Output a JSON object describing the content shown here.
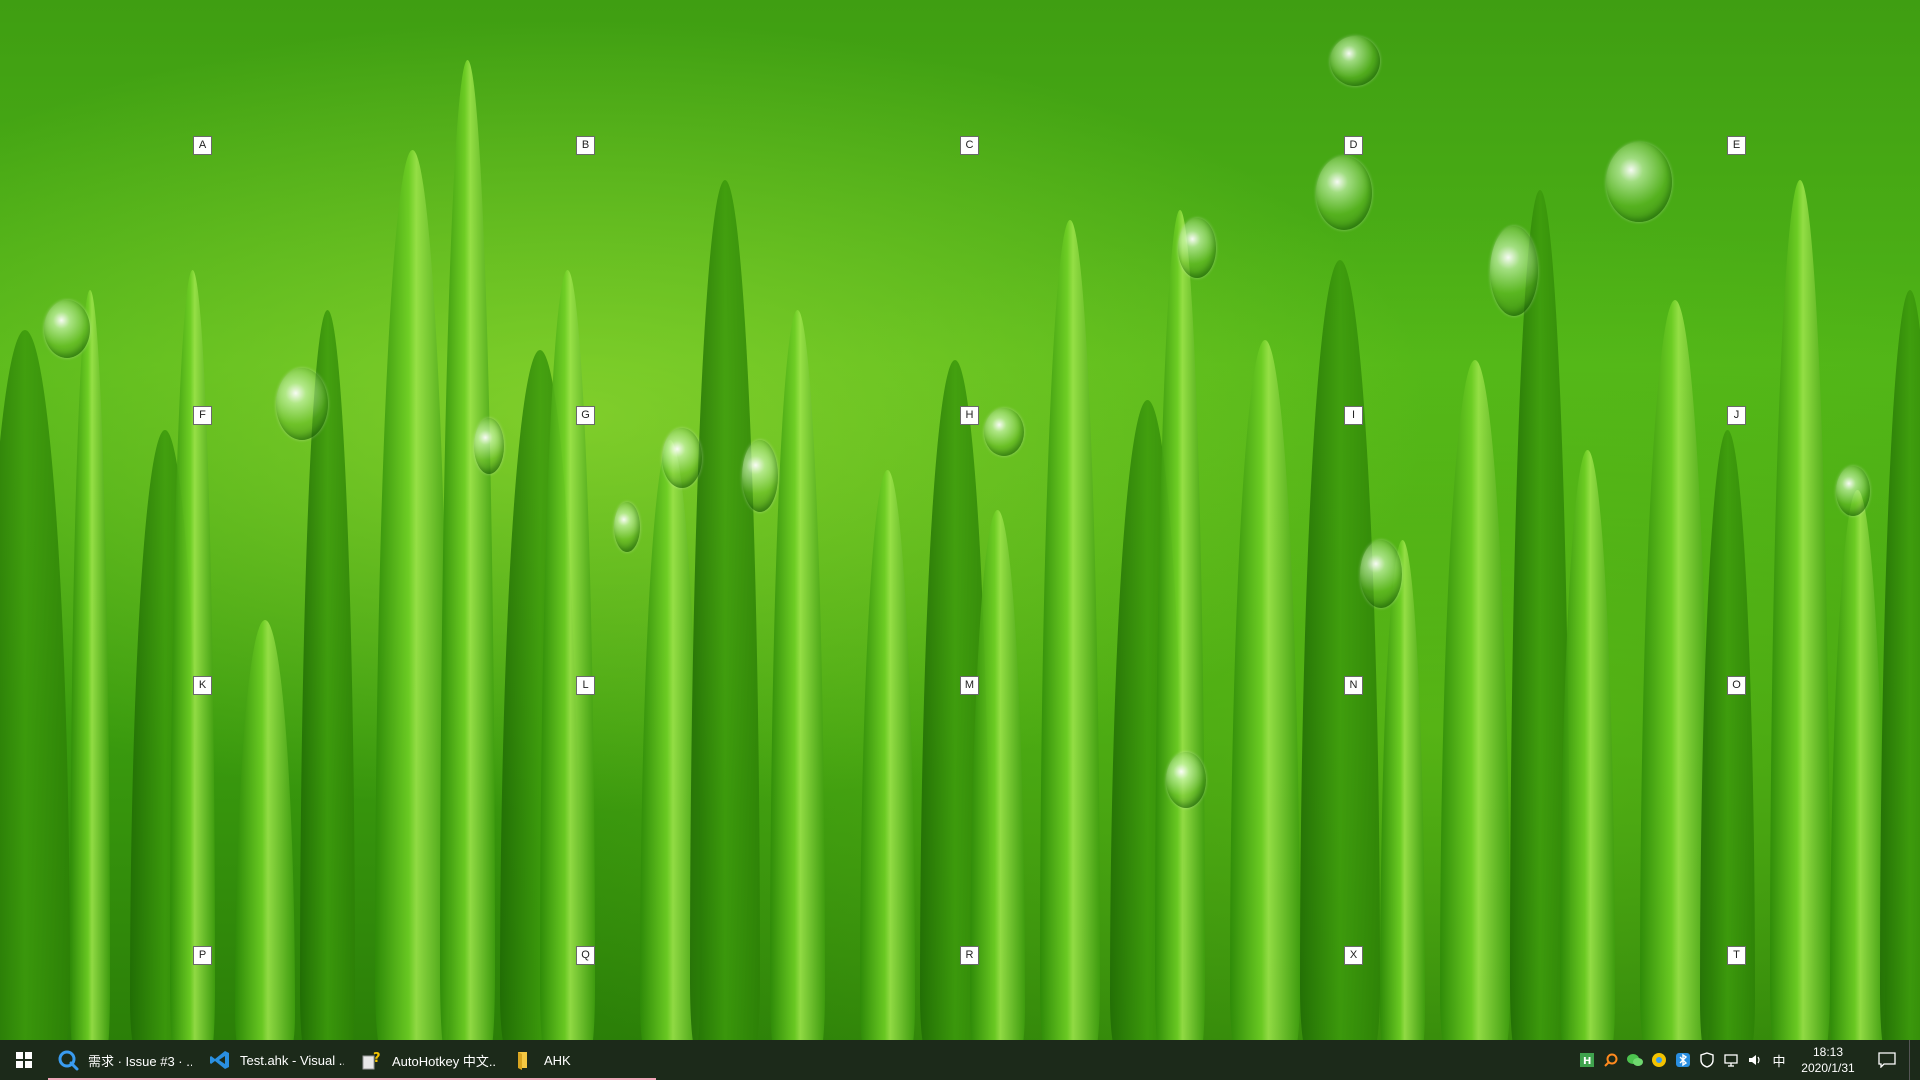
{
  "hints": [
    "A",
    "B",
    "C",
    "D",
    "E",
    "F",
    "G",
    "H",
    "I",
    "J",
    "K",
    "L",
    "M",
    "N",
    "O",
    "P",
    "Q",
    "R",
    "X",
    "T"
  ],
  "taskbar": {
    "tasks": [
      {
        "label": "需求 · Issue #3 · ...",
        "icon": "q-search-icon"
      },
      {
        "label": "Test.ahk - Visual ...",
        "icon": "vscode-icon"
      },
      {
        "label": "AutoHotkey 中文...",
        "icon": "autohotkey-help-icon"
      },
      {
        "label": "AHK",
        "icon": "folder-icon"
      }
    ],
    "tray": {
      "ime": "中",
      "time": "18:13",
      "date": "2020/1/31"
    }
  },
  "colors": {
    "taskbar": "#1c2a1a",
    "accent_underline": "#f0a5b8",
    "grass": "#4fb417"
  }
}
